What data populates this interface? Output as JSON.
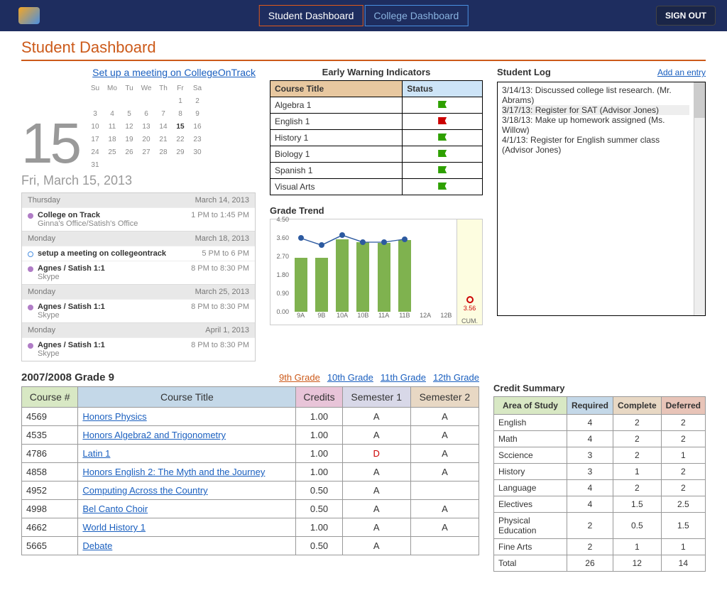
{
  "nav": {
    "student": "Student Dashboard",
    "college": "College Dashboard",
    "signout": "SIGN OUT"
  },
  "page_title": "Student Dashboard",
  "calendar": {
    "meeting_link": "Set up a meeting on CollegeOnTrack",
    "big_date": "15",
    "date_label": "Fri, March 15, 2013",
    "dow": [
      "Su",
      "Mo",
      "Tu",
      "We",
      "Th",
      "Fr",
      "Sa"
    ],
    "cells": [
      "",
      "",
      "",
      "",
      "",
      "1",
      "2",
      "3",
      "4",
      "5",
      "6",
      "7",
      "8",
      "9",
      "10",
      "11",
      "12",
      "13",
      "14",
      "15",
      "16",
      "17",
      "18",
      "19",
      "20",
      "21",
      "22",
      "23",
      "24",
      "25",
      "26",
      "27",
      "28",
      "29",
      "30",
      "31",
      "",
      "",
      "",
      "",
      "",
      ""
    ],
    "today_index": 19
  },
  "agenda": [
    {
      "day": "Thursday",
      "date": "March 14, 2013",
      "items": [
        {
          "title": "College on Track",
          "sub": "Ginna's Office/Satish's Office",
          "time": "1 PM to 1:45 PM",
          "dot": "purple"
        }
      ]
    },
    {
      "day": "Monday",
      "date": "March 18, 2013",
      "items": [
        {
          "title": "setup a meeting on collegeontrack",
          "sub": "",
          "time": "5 PM to 6 PM",
          "dot": "blue"
        },
        {
          "title": "Agnes / Satish 1:1",
          "sub": "Skype",
          "time": "8 PM to 8:30 PM",
          "dot": "purple"
        }
      ]
    },
    {
      "day": "Monday",
      "date": "March 25, 2013",
      "items": [
        {
          "title": "Agnes / Satish 1:1",
          "sub": "Skype",
          "time": "8 PM to 8:30 PM",
          "dot": "purple"
        }
      ]
    },
    {
      "day": "Monday",
      "date": "April 1, 2013",
      "items": [
        {
          "title": "Agnes / Satish 1:1",
          "sub": "Skype",
          "time": "8 PM to 8:30 PM",
          "dot": "purple"
        }
      ]
    }
  ],
  "ewi": {
    "title": "Early Warning Indicators",
    "headers": [
      "Course Title",
      "Status"
    ],
    "rows": [
      {
        "course": "Algebra 1",
        "status": "green"
      },
      {
        "course": "English 1",
        "status": "red"
      },
      {
        "course": "History 1",
        "status": "green"
      },
      {
        "course": "Biology 1",
        "status": "green"
      },
      {
        "course": "Spanish 1",
        "status": "green"
      },
      {
        "course": "Visual Arts",
        "status": "green"
      }
    ]
  },
  "chart_data": {
    "type": "bar",
    "title": "Grade Trend",
    "categories": [
      "9A",
      "9B",
      "10A",
      "10B",
      "11A",
      "11B",
      "12A",
      "12B"
    ],
    "bars": [
      2.7,
      2.7,
      3.65,
      3.5,
      3.45,
      3.6,
      null,
      null
    ],
    "line": [
      3.7,
      3.35,
      3.85,
      3.5,
      3.5,
      3.65,
      null,
      null
    ],
    "ylim": [
      0,
      4.5
    ],
    "yticks": [
      0,
      0.9,
      1.8,
      2.7,
      3.6,
      4.5
    ],
    "cum_label": "CUM.",
    "cum_value": 3.56
  },
  "log": {
    "title": "Student Log",
    "add": "Add an entry",
    "entries": [
      "3/14/13: Discussed college list research. (Mr. Abrams)",
      "3/17/13: Register for SAT (Advisor Jones)",
      "3/18/13: Make up homework assigned (Ms. Willow)",
      "4/1/13: Register for English summer class (Advisor Jones)"
    ]
  },
  "courses": {
    "year": "2007/2008 Grade 9",
    "grade_links": [
      "9th Grade",
      "10th Grade",
      "11th Grade",
      "12th Grade"
    ],
    "headers": [
      "Course #",
      "Course Title",
      "Credits",
      "Semester 1",
      "Semester 2"
    ],
    "rows": [
      {
        "num": "4569",
        "title": "Honors Physics",
        "credits": "1.00",
        "s1": "A",
        "s2": "A"
      },
      {
        "num": "4535",
        "title": "Honors Algebra2 and Trigonometry",
        "credits": "1.00",
        "s1": "A",
        "s2": "A"
      },
      {
        "num": "4786",
        "title": "Latin 1",
        "credits": "1.00",
        "s1": "D",
        "s2": "A"
      },
      {
        "num": "4858",
        "title": "Honors English 2: The Myth and the Journey",
        "credits": "1.00",
        "s1": "A",
        "s2": "A"
      },
      {
        "num": "4952",
        "title": "Computing Across the Country",
        "credits": "0.50",
        "s1": "A",
        "s2": ""
      },
      {
        "num": "4998",
        "title": "Bel Canto Choir",
        "credits": "0.50",
        "s1": "A",
        "s2": "A"
      },
      {
        "num": "4662",
        "title": "World History 1",
        "credits": "1.00",
        "s1": "A",
        "s2": "A"
      },
      {
        "num": "5665",
        "title": "Debate",
        "credits": "0.50",
        "s1": "A",
        "s2": ""
      }
    ]
  },
  "credits": {
    "title": "Credit Summary",
    "headers": [
      "Area of Study",
      "Required",
      "Complete",
      "Deferred"
    ],
    "rows": [
      {
        "a": "English",
        "r": "4",
        "c": "2",
        "d": "2"
      },
      {
        "a": "Math",
        "r": "4",
        "c": "2",
        "d": "2"
      },
      {
        "a": "Sccience",
        "r": "3",
        "c": "2",
        "d": "1"
      },
      {
        "a": "History",
        "r": "3",
        "c": "1",
        "d": "2"
      },
      {
        "a": "Language",
        "r": "4",
        "c": "2",
        "d": "2"
      },
      {
        "a": "Electives",
        "r": "4",
        "c": "1.5",
        "d": "2.5"
      },
      {
        "a": "Physical Education",
        "r": "2",
        "c": "0.5",
        "d": "1.5"
      },
      {
        "a": "Fine Arts",
        "r": "2",
        "c": "1",
        "d": "1"
      },
      {
        "a": "Total",
        "r": "26",
        "c": "12",
        "d": "14"
      }
    ]
  }
}
